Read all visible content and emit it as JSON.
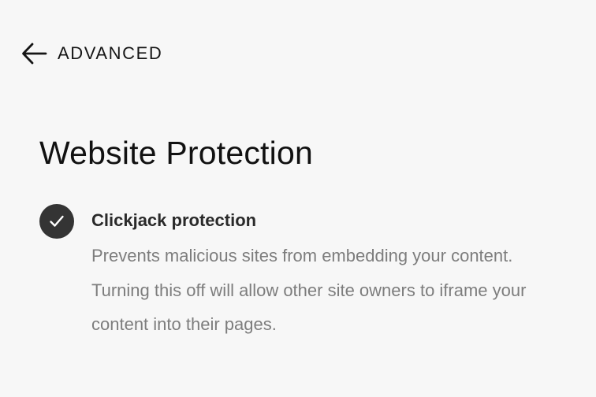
{
  "nav": {
    "back_label": "ADVANCED",
    "back_icon": "arrow-left-icon"
  },
  "page": {
    "title": "Website Protection"
  },
  "setting": {
    "title": "Clickjack protection",
    "description": "Prevents malicious sites from embedding your content. Turning this off will allow other site owners to iframe your content into their pages.",
    "enabled": true,
    "check_icon": "checkmark-icon"
  },
  "colors": {
    "background": "#f7f7f7",
    "check_fill": "#343434",
    "heading_text": "#111111",
    "description_text": "#7d7d7d"
  }
}
